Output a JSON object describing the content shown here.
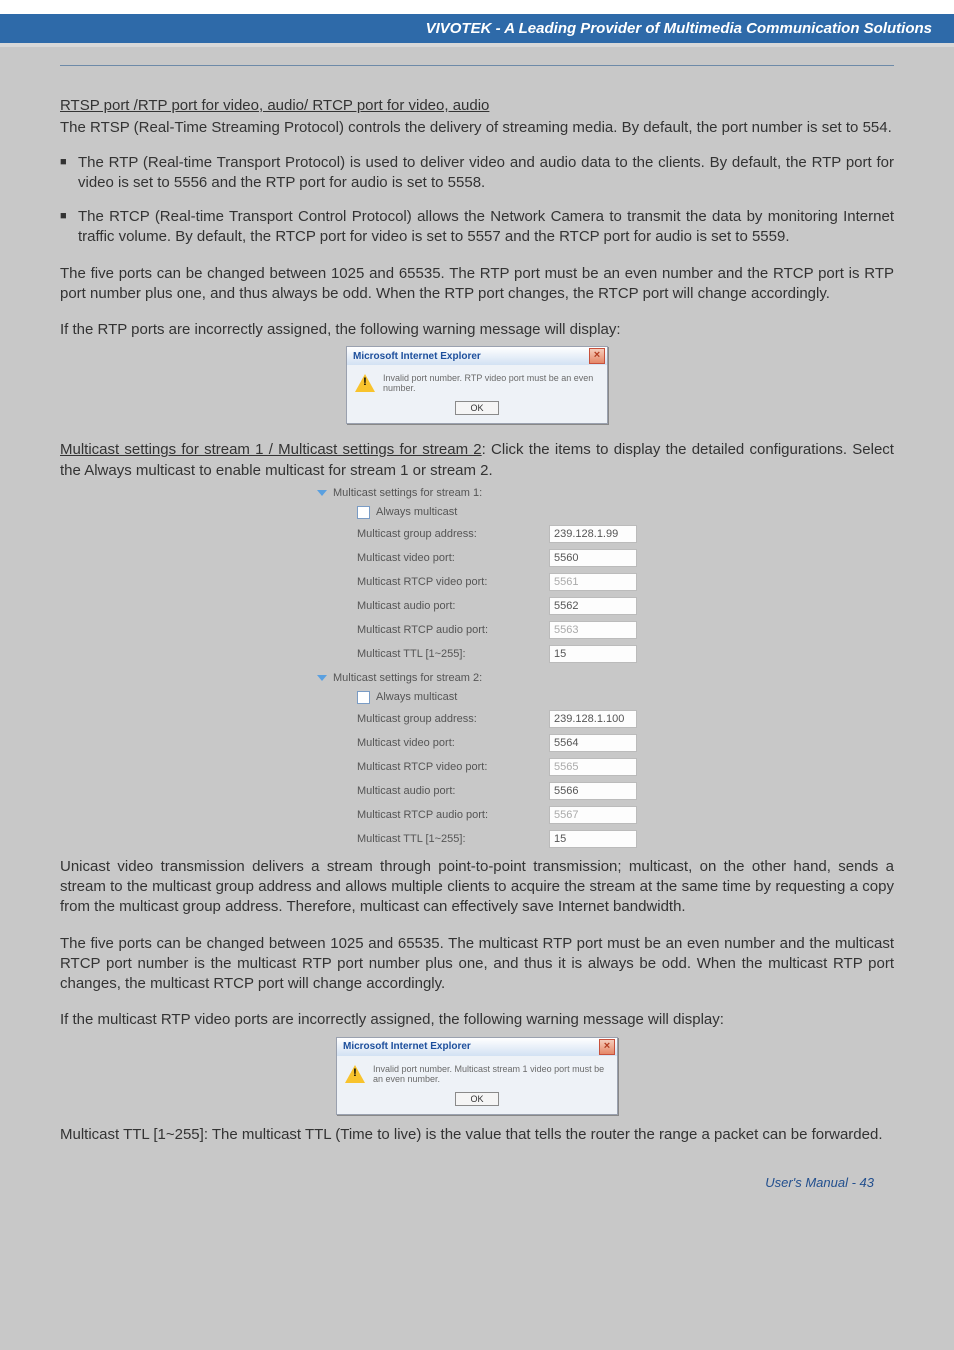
{
  "header": {
    "brand_tagline": "VIVOTEK - A Leading Provider of Multimedia Communication Solutions"
  },
  "section_rtsp": {
    "heading": "RTSP port /RTP port for video, audio/ RTCP port for video, audio",
    "intro": "The RTSP (Real-Time Streaming Protocol) controls the delivery of streaming media. By default, the port number is set to 554.",
    "bullet_rtp": "The RTP (Real-time Transport Protocol) is used to deliver video and audio data to the clients. By default, the RTP port for video is set to 5556 and the RTP port for audio is set to 5558.",
    "bullet_rtcp": "The RTCP (Real-time Transport Control Protocol) allows the Network Camera to transmit the data by monitoring Internet traffic volume. By default, the RTCP port for video is set to 5557 and the RTCP port for audio is set to 5559.",
    "ports_note": "The five ports can be changed between 1025 and 65535. The RTP port must be an even number and the RTCP port is RTP port number plus one, and thus always be odd. When the RTP port changes, the RTCP port will change accordingly.",
    "warn_intro": "If the RTP ports are incorrectly assigned, the following warning message will display:"
  },
  "dialog1": {
    "title": "Microsoft Internet Explorer",
    "message": "Invalid port number. RTP video port must be an even number.",
    "ok": "OK"
  },
  "section_multicast": {
    "heading": "Multicast settings for stream 1 / Multicast settings for stream 2",
    "heading_rest": ": Click the items to display the detailed configurations. Select the Always multicast to enable multicast for stream 1 or stream 2.",
    "unicast_para": "Unicast video transmission delivers a stream through point-to-point transmission; multicast, on the other hand, sends a stream to the multicast group address and allows multiple clients to acquire the stream at the same time by requesting a copy from the multicast group address. Therefore, multicast can effectively save Internet bandwidth.",
    "ports_note2": "The five ports can be changed between 1025 and 65535. The multicast RTP port must be an even number and the multicast RTCP port number is the multicast RTP port number plus one, and thus it is always be odd. When the multicast RTP port changes, the multicast RTCP port will change accordingly.",
    "warn_intro2": "If the multicast RTP video ports are incorrectly assigned, the following warning message will display:",
    "ttl_para": "Multicast TTL [1~255]: The multicast TTL (Time to live) is the value that tells the router the range a packet can be forwarded."
  },
  "mcast_form": {
    "stream1": {
      "title": "Multicast settings for stream 1:",
      "always": "Always multicast",
      "rows": [
        {
          "label": "Multicast group address:",
          "value": "239.128.1.99",
          "disabled": false
        },
        {
          "label": "Multicast video port:",
          "value": "5560",
          "disabled": false
        },
        {
          "label": "Multicast RTCP video port:",
          "value": "5561",
          "disabled": true
        },
        {
          "label": "Multicast audio port:",
          "value": "5562",
          "disabled": false
        },
        {
          "label": "Multicast RTCP audio port:",
          "value": "5563",
          "disabled": true
        },
        {
          "label": "Multicast TTL [1~255]:",
          "value": "15",
          "disabled": false
        }
      ]
    },
    "stream2": {
      "title": "Multicast settings for stream 2:",
      "always": "Always multicast",
      "rows": [
        {
          "label": "Multicast group address:",
          "value": "239.128.1.100",
          "disabled": false
        },
        {
          "label": "Multicast video port:",
          "value": "5564",
          "disabled": false
        },
        {
          "label": "Multicast RTCP video port:",
          "value": "5565",
          "disabled": true
        },
        {
          "label": "Multicast audio port:",
          "value": "5566",
          "disabled": false
        },
        {
          "label": "Multicast RTCP audio port:",
          "value": "5567",
          "disabled": true
        },
        {
          "label": "Multicast TTL [1~255]:",
          "value": "15",
          "disabled": false
        }
      ]
    }
  },
  "dialog2": {
    "title": "Microsoft Internet Explorer",
    "message": "Invalid port number. Multicast stream 1 video port must be an even number.",
    "ok": "OK"
  },
  "footer": {
    "text": "User's Manual - 43"
  }
}
